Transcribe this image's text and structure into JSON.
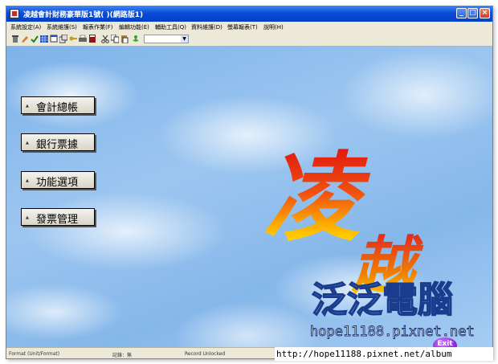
{
  "window": {
    "title": "凌越會計財務豪華版1號(      )(網路版1)"
  },
  "menubar": {
    "items": [
      "系統設定(A)",
      "系統維護(S)",
      "報表作業(F)",
      "編輯功能(E)",
      "輔助工具(Q)",
      "資料維護(D)",
      "螢幕報表(T)",
      "說明(H)"
    ]
  },
  "main_menu": {
    "buttons": [
      "會計總帳",
      "銀行票據",
      "功能選項",
      "發票管理"
    ]
  },
  "logo": {
    "chars": [
      "凌",
      "越"
    ],
    "brand": "泛泛電腦",
    "site": "hope11188.pixnet.net",
    "exit_label": "Exit"
  },
  "statusbar": {
    "left": "Format (Unit/Format)",
    "mid": "記錄：無",
    "right": "Record Unlocked"
  },
  "watermark": {
    "url": "http://hope11188.pixnet.net/album"
  },
  "colors": {
    "titlebar": "#0a4bd6",
    "brand_text": "#6fa8e8",
    "exit_button": "#8a2be2"
  }
}
